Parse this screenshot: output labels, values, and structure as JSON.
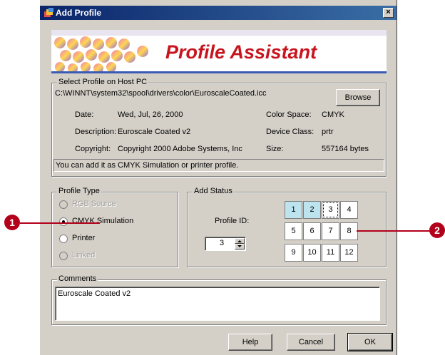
{
  "window": {
    "title": "Add Profile",
    "close_glyph": "×"
  },
  "banner": {
    "title": "Profile Assistant"
  },
  "select_profile": {
    "legend": "Select Profile on Host PC",
    "path": "C:\\WINNT\\system32\\spool\\drivers\\color\\EuroscaleCoated.icc",
    "browse_label": "Browse",
    "date_label": "Date:",
    "date_value": "Wed, Jul, 26, 2000",
    "description_label": "Description:",
    "description_value": "Euroscale Coated v2",
    "copyright_label": "Copyright:",
    "copyright_value": "Copyright 2000 Adobe Systems, Inc",
    "color_space_label": "Color Space:",
    "color_space_value": "CMYK",
    "device_class_label": "Device Class:",
    "device_class_value": "prtr",
    "size_label": "Size:",
    "size_value": "557164 bytes",
    "hint": "You can add it as CMYK Simulation or printer profile."
  },
  "profile_type": {
    "legend": "Profile Type",
    "options": [
      {
        "label": "RGB Source",
        "checked": false,
        "enabled": false
      },
      {
        "label": "CMYK Simulation",
        "checked": true,
        "enabled": true
      },
      {
        "label": "Printer",
        "checked": false,
        "enabled": true
      },
      {
        "label": "Linked",
        "checked": false,
        "enabled": false
      }
    ]
  },
  "add_status": {
    "legend": "Add Status",
    "profile_id_label": "Profile ID:",
    "profile_id_value": "3",
    "slots": [
      "1",
      "2",
      "3",
      "4",
      "5",
      "6",
      "7",
      "8",
      "9",
      "10",
      "11",
      "12"
    ],
    "used_slots": [
      1,
      2
    ],
    "selected_slot": 3
  },
  "comments": {
    "legend": "Comments",
    "value": "Euroscale Coated v2"
  },
  "footer": {
    "help_label": "Help",
    "cancel_label": "Cancel",
    "ok_label": "OK"
  },
  "callouts": {
    "one": "1",
    "two": "2"
  },
  "colors": {
    "banner_title": "#c8141e",
    "callout": "#b3001b",
    "used_slot": "#bde4ee",
    "titlebar": "#0a246a"
  }
}
